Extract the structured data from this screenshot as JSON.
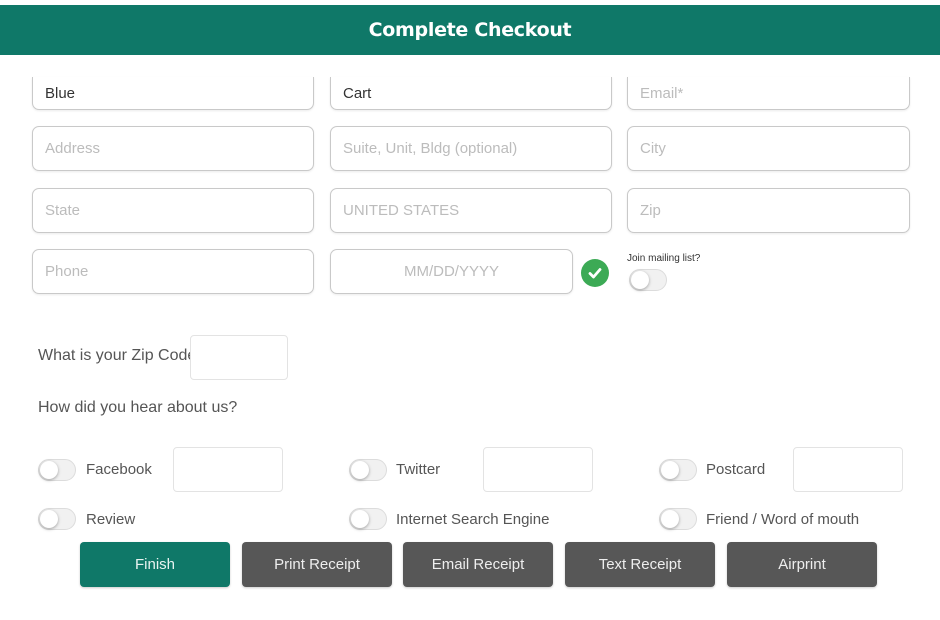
{
  "header": {
    "title": "Complete Checkout"
  },
  "form": {
    "first_name": {
      "value": "Blue",
      "placeholder": ""
    },
    "last_name": {
      "value": "Cart",
      "placeholder": ""
    },
    "email": {
      "value": "",
      "placeholder": "Email*"
    },
    "address": {
      "value": "",
      "placeholder": "Address"
    },
    "suite": {
      "value": "",
      "placeholder": "Suite, Unit, Bldg (optional)"
    },
    "city": {
      "value": "",
      "placeholder": "City"
    },
    "state": {
      "value": "",
      "placeholder": "State"
    },
    "country": {
      "value": "",
      "placeholder": "UNITED STATES"
    },
    "zip": {
      "value": "",
      "placeholder": "Zip"
    },
    "phone": {
      "value": "",
      "placeholder": "Phone"
    },
    "birthdate": {
      "value": "",
      "placeholder": "MM/DD/YYYY"
    },
    "mailing_list_label": "Join mailing list?"
  },
  "zip_question": "What is your Zip Code?",
  "hear_question": "How did you hear about us?",
  "sources": [
    {
      "label": "Facebook"
    },
    {
      "label": "Twitter"
    },
    {
      "label": "Postcard"
    },
    {
      "label": "Review"
    },
    {
      "label": "Internet Search Engine"
    },
    {
      "label": "Friend / Word of mouth"
    }
  ],
  "buttons": {
    "finish": "Finish",
    "print": "Print Receipt",
    "email": "Email Receipt",
    "text": "Text Receipt",
    "airprint": "Airprint"
  },
  "colors": {
    "brand": "#0f7868",
    "dark_button": "#575757",
    "check": "#3caa55"
  }
}
